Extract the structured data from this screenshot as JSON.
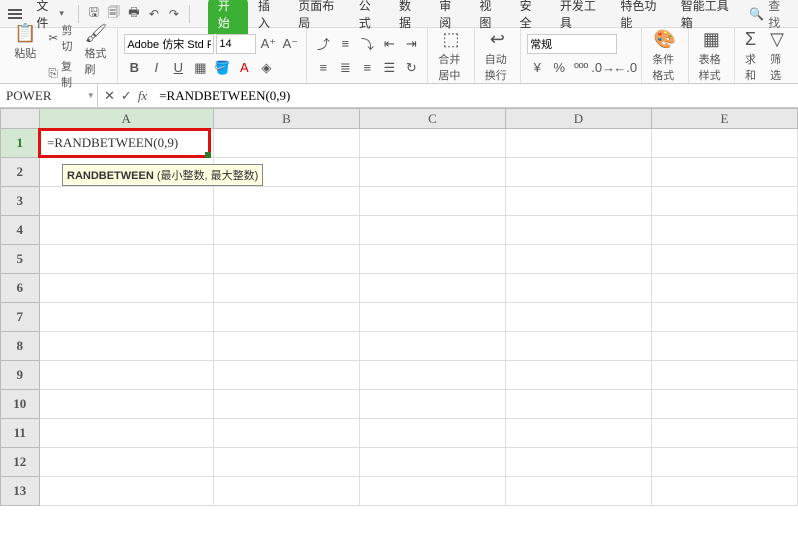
{
  "file_menu": "文件",
  "tabs": [
    "开始",
    "插入",
    "页面布局",
    "公式",
    "数据",
    "审阅",
    "视图",
    "安全",
    "开发工具",
    "特色功能",
    "智能工具箱"
  ],
  "active_tab_index": 0,
  "search_label": "查找",
  "ribbon": {
    "paste": "粘贴",
    "cut": "剪切",
    "copy": "复制",
    "format_painter": "格式刷",
    "font_name": "Adobe 仿宋 Std R",
    "font_size": "14",
    "merge_center": "合并居中",
    "wrap_text": "自动换行",
    "num_format": "常规",
    "cond_format": "条件格式",
    "table_style": "表格样式",
    "sum": "求和",
    "filter": "筛选"
  },
  "name_box": "POWER",
  "formula_value": "=RANDBETWEEN(0,9)",
  "cell_A1": "=RANDBETWEEN(0,9)",
  "fn_hint_name": "RANDBETWEEN",
  "fn_hint_args": " (最小整数, 最大整数)",
  "columns": [
    "A",
    "B",
    "C",
    "D",
    "E"
  ],
  "row_count": 13
}
